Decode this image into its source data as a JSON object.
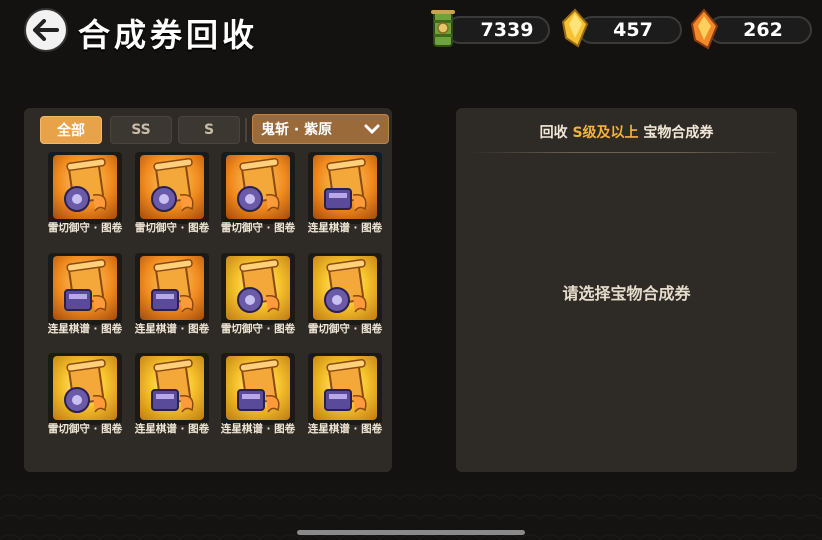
{
  "header": {
    "title": "合成券回收",
    "back_label": "back"
  },
  "currencies": [
    {
      "name": "bamboo-scroll",
      "value": "7339"
    },
    {
      "name": "gold-crystal",
      "value": "457"
    },
    {
      "name": "flame-crystal",
      "value": "262"
    }
  ],
  "filters": {
    "tabs": [
      {
        "label": "全部",
        "active": true
      },
      {
        "label": "SS",
        "active": false
      },
      {
        "label": "S",
        "active": false
      }
    ],
    "dropdown_value": "鬼斩 · 紫原"
  },
  "items": [
    {
      "name": "雷切御守 · 图卷",
      "type": "charm",
      "tone": "orange"
    },
    {
      "name": "雷切御守 · 图卷",
      "type": "charm",
      "tone": "orange"
    },
    {
      "name": "雷切御守 · 图卷",
      "type": "charm",
      "tone": "orange"
    },
    {
      "name": "连星棋谱 · 图卷",
      "type": "book",
      "tone": "orange"
    },
    {
      "name": "连星棋谱 · 图卷",
      "type": "book",
      "tone": "orange"
    },
    {
      "name": "连星棋谱 · 图卷",
      "type": "book",
      "tone": "orange"
    },
    {
      "name": "雷切御守 · 图卷",
      "type": "charm",
      "tone": "gold"
    },
    {
      "name": "雷切御守 · 图卷",
      "type": "charm",
      "tone": "gold"
    },
    {
      "name": "雷切御守 · 图卷",
      "type": "charm",
      "tone": "gold"
    },
    {
      "name": "连星棋谱 · 图卷",
      "type": "book",
      "tone": "gold"
    },
    {
      "name": "连星棋谱 · 图卷",
      "type": "book",
      "tone": "gold"
    },
    {
      "name": "连星棋谱 · 图卷",
      "type": "book",
      "tone": "gold"
    }
  ],
  "recycle": {
    "title_prefix": "回收",
    "title_highlight": "S级及以上",
    "title_suffix": "宝物合成券",
    "empty_hint": "请选择宝物合成券"
  },
  "colors": {
    "accent": "#e8a24a",
    "highlight": "#f5b23a",
    "panel": "#2e2a25"
  }
}
